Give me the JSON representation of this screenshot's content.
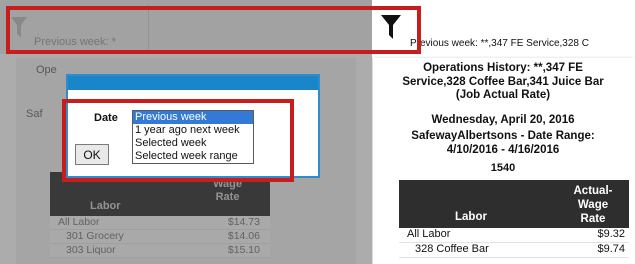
{
  "left_panel": {
    "filter_label": "Previous week: *",
    "report_ops_label": "Ope",
    "report_saf_label": "Saf",
    "table": {
      "col_labor": "Labor",
      "col_wage_line1": "Wage",
      "col_wage_line2": "Rate",
      "rows": [
        {
          "name": "All Labor",
          "value": "$14.73"
        },
        {
          "name": "301 Grocery",
          "value": "$14.06"
        },
        {
          "name": "303 Liquor",
          "value": "$15.10"
        }
      ]
    }
  },
  "modal": {
    "date_label": "Date",
    "ok_label": "OK",
    "options": [
      "Previous week",
      "1 year ago next week",
      "Selected week",
      "Selected week range"
    ],
    "selected_option": "Previous week"
  },
  "right_panel": {
    "filter_label": "Previous week: **,347 FE Service,328 C",
    "report": {
      "title": "Operations History: **,347 FE Service,328 Coffee Bar,341 Juice Bar (Job Actual Rate)",
      "date": "Wednesday, April 20, 2016",
      "range": "SafewayAlbertsons - Date Range: 4/10/2016 - 4/16/2016",
      "code": "1540",
      "table": {
        "col_labor": "Labor",
        "col_rate_line1": "Actual-",
        "col_rate_line2": "Wage",
        "col_rate_line3": "Rate",
        "rows": [
          {
            "name": "All Labor",
            "value": "$9.32"
          },
          {
            "name": "328 Coffee Bar",
            "value": "$9.74"
          }
        ]
      }
    }
  },
  "colors": {
    "highlight": "#c71d1d",
    "modal_title": "#1a86c9",
    "selected_option": "#3379d6",
    "table_header": "#2e2e2e"
  },
  "icons": [
    "filter-icon"
  ]
}
